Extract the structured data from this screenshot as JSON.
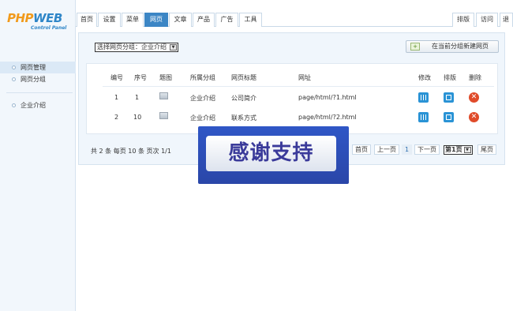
{
  "logo": {
    "main_a": "PHP",
    "main_b": "WEB",
    "sub": "Control Panel"
  },
  "sidebar": {
    "items": [
      {
        "label": "网页管理"
      },
      {
        "label": "网页分组"
      }
    ],
    "groups": [
      {
        "label": "企业介绍"
      }
    ]
  },
  "topnav": {
    "tabs": [
      {
        "label": "首页"
      },
      {
        "label": "设置"
      },
      {
        "label": "菜单"
      },
      {
        "label": "网页"
      },
      {
        "label": "文章"
      },
      {
        "label": "产品"
      },
      {
        "label": "广告"
      },
      {
        "label": "工具"
      }
    ],
    "right_tabs": [
      {
        "label": "排版"
      },
      {
        "label": "访问"
      },
      {
        "label": "退出"
      }
    ],
    "active_tab": "网页"
  },
  "toolbar": {
    "group_select": "选择网页分组：企业介绍",
    "new_button": "在当前分组新建网页"
  },
  "table": {
    "headers": [
      "编号",
      "序号",
      "题图",
      "所属分组",
      "网页标题",
      "网址",
      "修改",
      "排版",
      "删除"
    ],
    "rows": [
      {
        "id": "1",
        "order": "1",
        "group": "企业介绍",
        "title": "公司简介",
        "url": "page/html/?1.html"
      },
      {
        "id": "2",
        "order": "10",
        "group": "企业介绍",
        "title": "联系方式",
        "url": "page/html/?2.html"
      }
    ]
  },
  "pager": {
    "info": "共 2 条  每页  10 条  页次  1/1",
    "first": "首页",
    "prev": "上一页",
    "current": "1",
    "next": "下一页",
    "select": "第1页",
    "last": "尾页"
  },
  "banner": {
    "text": "感谢支持"
  },
  "colors": {
    "accent": "#3c86c5",
    "panel_bg": "#f0f6fc",
    "delete_red": "#e04b2a",
    "banner_blue": "#2f56c6"
  }
}
